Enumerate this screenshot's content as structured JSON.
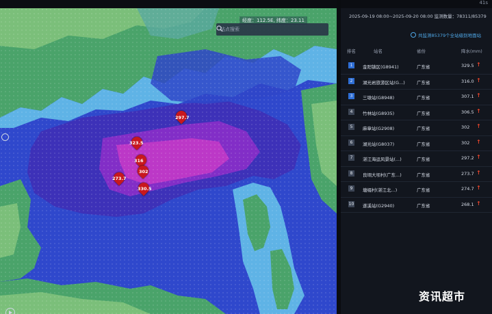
{
  "topbar": {
    "right_text": "41s"
  },
  "map": {
    "coord_text": "经度：112.5E, 纬度：23.11",
    "search_placeholder": "站点搜索",
    "labels": [
      "297.7",
      "323.5",
      "316",
      "302",
      "273.7",
      "330.5"
    ]
  },
  "panel": {
    "date_range": "2025-09-19 08:00~2025-09-20 08:00 监测数量：78311/85379",
    "count_text": "共监测85379个全站级别地面站",
    "headers": {
      "rank": "排名",
      "station": "站名",
      "province": "省份",
      "value": "降水(mm)"
    },
    "rows": [
      {
        "rank": "1",
        "station": "金阳镇区(G8941)",
        "province": "广东省",
        "value": "329.5"
      },
      {
        "rank": "2",
        "station": "湖光岩旅游区站(G...)",
        "province": "广东省",
        "value": "316.0"
      },
      {
        "rank": "3",
        "station": "三墩站(G8948)",
        "province": "广东省",
        "value": "307.1"
      },
      {
        "rank": "4",
        "station": "竹林站(G8935)",
        "province": "广东省",
        "value": "306.5"
      },
      {
        "rank": "5",
        "station": "麻章站(G2908)",
        "province": "广东省",
        "value": "302"
      },
      {
        "rank": "6",
        "station": "湖光站(G8037)",
        "province": "广东省",
        "value": "302"
      },
      {
        "rank": "7",
        "station": "湛江海运风景站(...)",
        "province": "广东省",
        "value": "297.2"
      },
      {
        "rank": "8",
        "station": "良垌大坝村(广东...)",
        "province": "广东省",
        "value": "273.7"
      },
      {
        "rank": "9",
        "station": "塘缀村(湛江北...)",
        "province": "广东省",
        "value": "274.7"
      },
      {
        "rank": "10",
        "station": "遂溪站(G2940)",
        "province": "广东省",
        "value": "268.1"
      }
    ]
  },
  "watermark": "资讯超市",
  "icons": {
    "search": "search-icon",
    "arrow": "up-arrow-icon",
    "play": "play-icon"
  },
  "colors": {
    "accent": "#2f6fd6",
    "rain_heavy": "#c23ac7",
    "rain_moderate": "#2f46c8",
    "arrow": "#e8452c"
  }
}
